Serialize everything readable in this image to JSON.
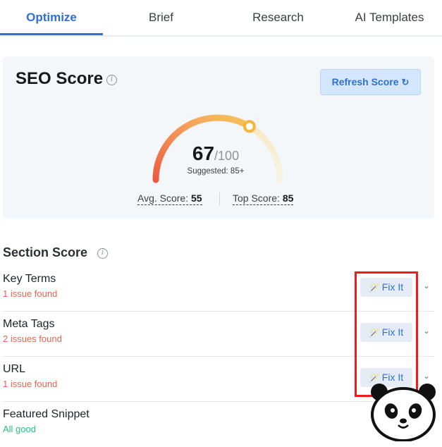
{
  "tabs": [
    {
      "label": "Optimize",
      "active": true
    },
    {
      "label": "Brief",
      "active": false
    },
    {
      "label": "Research",
      "active": false
    },
    {
      "label": "AI Templates",
      "active": false
    }
  ],
  "seo": {
    "title": "SEO Score",
    "info_icon": "info-icon",
    "refresh_label": "Refresh Score",
    "refresh_icon": "refresh-icon",
    "score": "67",
    "score_max": "/100",
    "score_value": 67,
    "suggested": "Suggested: 85+",
    "avg_label": "Avg. Score:",
    "avg_value": "55",
    "top_label": "Top Score:",
    "top_value": "85"
  },
  "section": {
    "title": "Section Score",
    "rows": [
      {
        "label": "Key Terms",
        "status": "1 issue found",
        "status_type": "bad",
        "fix_label": "Fix It"
      },
      {
        "label": "Meta Tags",
        "status": "2 issues found",
        "status_type": "bad",
        "fix_label": "Fix It"
      },
      {
        "label": "URL",
        "status": "1 issue found",
        "status_type": "bad",
        "fix_label": "Fix It"
      },
      {
        "label": "Featured Snippet",
        "status": "All good",
        "status_type": "good"
      }
    ]
  },
  "colors": {
    "accent": "#2f6fd6",
    "issue": "#e0664f",
    "good": "#2bbd7e",
    "highlight": "#ee1c1c"
  }
}
